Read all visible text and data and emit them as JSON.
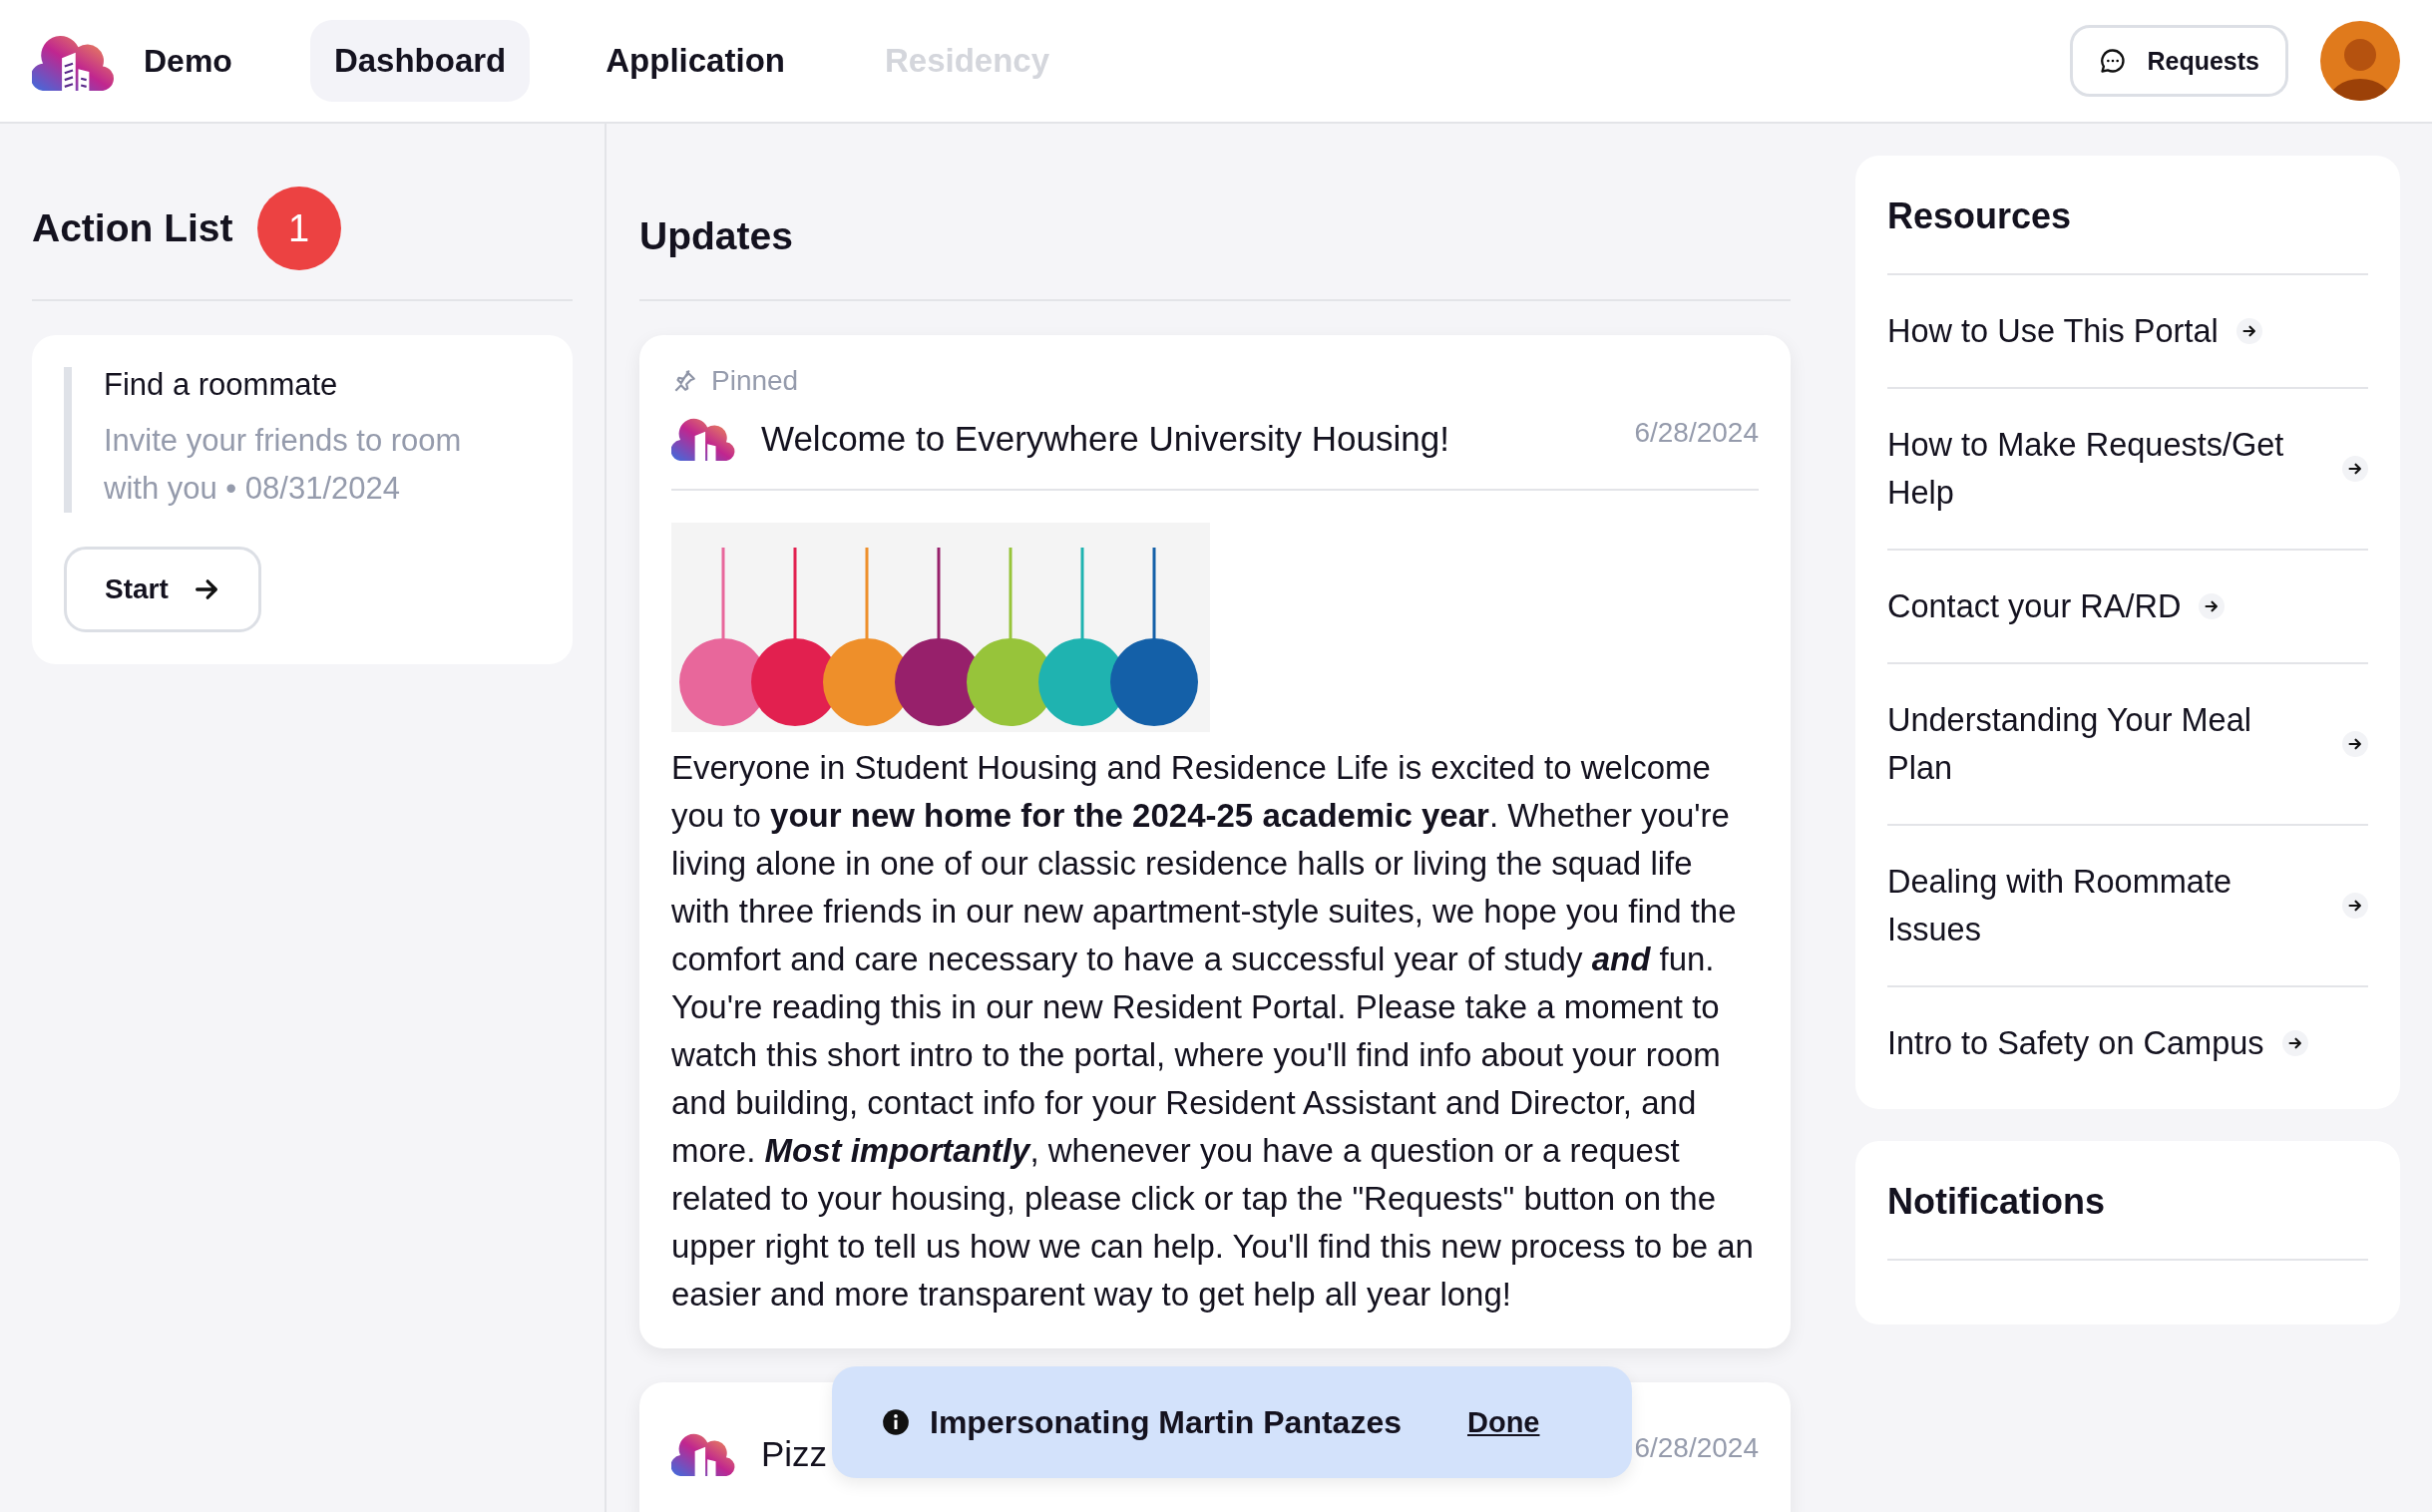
{
  "nav": {
    "brand": "Demo",
    "tabs": [
      {
        "label": "Dashboard",
        "selected": true,
        "disabled": false
      },
      {
        "label": "Application",
        "selected": false,
        "disabled": false
      },
      {
        "label": "Residency",
        "selected": false,
        "disabled": true
      }
    ],
    "requests_button": "Requests"
  },
  "action_list": {
    "title": "Action List",
    "count": "1",
    "items": [
      {
        "title": "Find a roommate",
        "description": "Invite your friends to room with you • 08/31/2024",
        "button": "Start"
      }
    ]
  },
  "updates": {
    "title": "Updates",
    "posts": [
      {
        "pinned": true,
        "pinned_label": "Pinned",
        "title": "Welcome to Everywhere University Housing!",
        "date": "6/28/2024",
        "body": "Everyone in Student Housing and Residence Life is excited to welcome you to **your new home for the 2024-25 academic year**. Whether you're living alone in one of our classic residence halls or living the squad life with three friends in our new apartment-style suites, we hope you find the comfort and care necessary to have a successful year of study *and* fun. You're reading this in our new Resident Portal. Please take a moment to watch this short intro to the portal, where you'll find info about your room and building, contact info for your Resident Assistant and Director, and more. *Most importantly*, whenever you have a question or a request related to your housing, please click or tap the \"Requests\" button on the upper right to tell us how we can help. You'll find this new process to be an easier and more transparent way to get help all year long!"
      },
      {
        "pinned": false,
        "title": "Pizz",
        "date": "6/28/2024"
      }
    ]
  },
  "resources": {
    "title": "Resources",
    "items": [
      "How to Use This Portal",
      "How to Make Requests/Get Help",
      "Contact your RA/RD",
      "Understanding Your Meal Plan",
      "Dealing with Roommate Issues",
      "Intro to Safety on Campus"
    ]
  },
  "notifications": {
    "title": "Notifications"
  },
  "toast": {
    "message": "Impersonating Martin Pantazes",
    "action": "Done"
  }
}
